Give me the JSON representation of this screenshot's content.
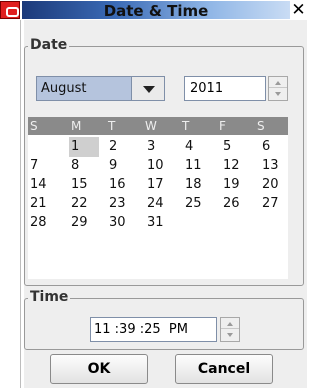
{
  "window": {
    "title": "Date & Time",
    "close_glyph": "✕"
  },
  "date_group": {
    "label": "Date",
    "month_selected": "August",
    "year_value": "2011"
  },
  "calendar": {
    "weekdays": [
      "S",
      "M",
      "T",
      "W",
      "T",
      "F",
      "S"
    ],
    "weeks": [
      [
        "",
        "1",
        "2",
        "3",
        "4",
        "5",
        "6"
      ],
      [
        "7",
        "8",
        "9",
        "10",
        "11",
        "12",
        "13"
      ],
      [
        "14",
        "15",
        "16",
        "17",
        "18",
        "19",
        "20"
      ],
      [
        "21",
        "22",
        "23",
        "24",
        "25",
        "26",
        "27"
      ],
      [
        "28",
        "29",
        "30",
        "31",
        "",
        "",
        ""
      ]
    ],
    "selected_day": "1"
  },
  "time_group": {
    "label": "Time",
    "value": "11 :39 :25  PM"
  },
  "buttons": {
    "ok_label": "OK",
    "cancel_label": "Cancel"
  },
  "colors": {
    "title_gradient_start": "#1c3a7a",
    "title_gradient_end": "#c9dcf4",
    "app_icon_red": "#e02020",
    "month_combo_bg": "#b5c4dd",
    "calendar_header_bg": "#8a8a8a",
    "selected_day_bg": "#cfcfcf"
  }
}
